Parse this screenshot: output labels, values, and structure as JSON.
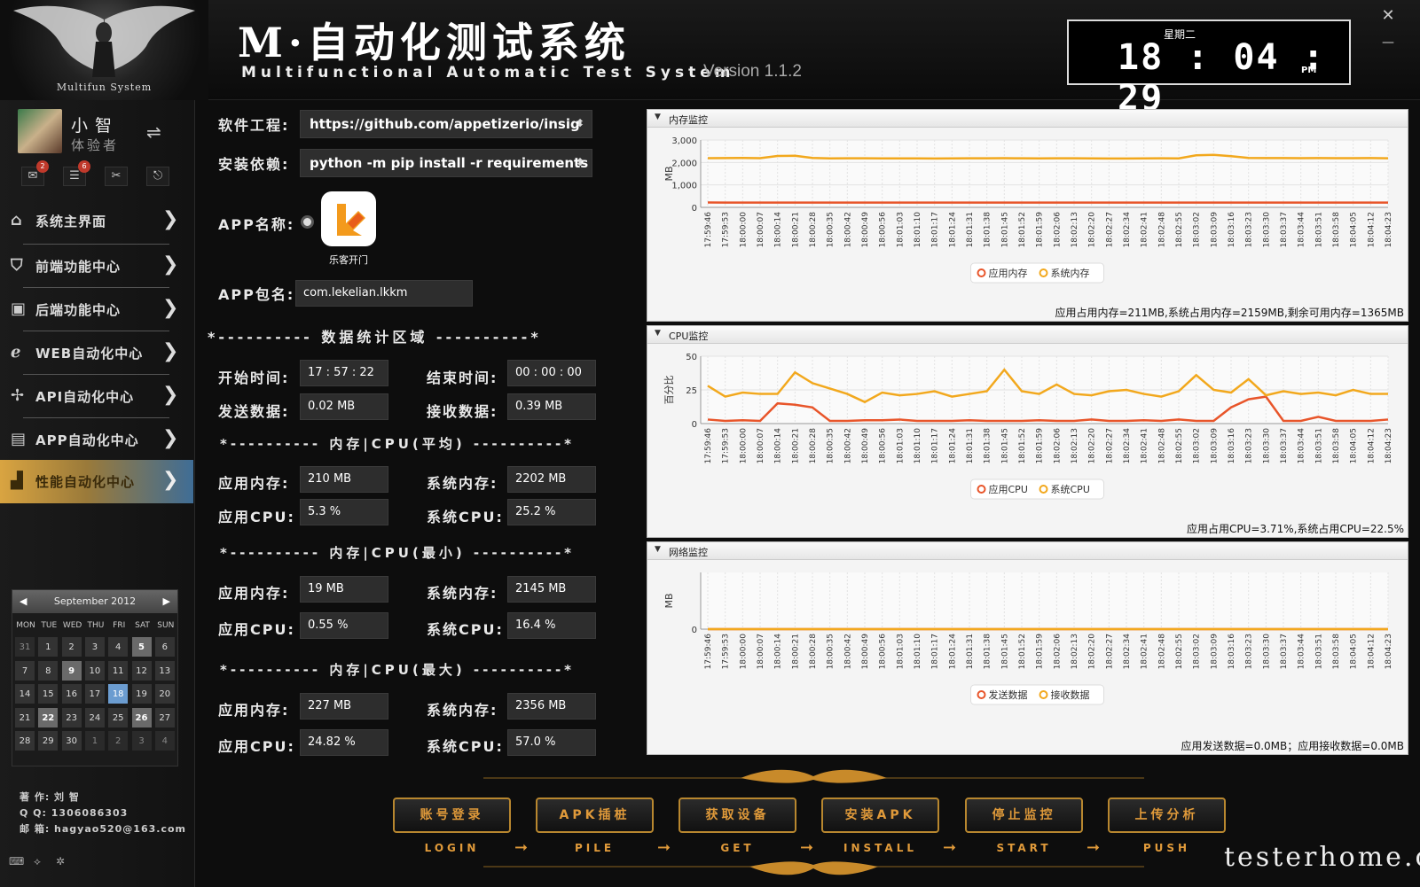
{
  "header": {
    "logo_text": "Multifun System",
    "title": "M·自动化测试系统",
    "subtitle": "Multifunctional Automatic Test System",
    "version": "Version 1.1.2",
    "clock": {
      "weekday": "星期二",
      "time": "18 : 04 : 29",
      "ampm": "PM"
    }
  },
  "user": {
    "name": "小智",
    "role": "体验者",
    "badges": [
      "2",
      "6"
    ]
  },
  "nav": [
    {
      "label": "系统主界面",
      "icon": "home-icon"
    },
    {
      "label": "前端功能中心",
      "icon": "shield-icon"
    },
    {
      "label": "后端功能中心",
      "icon": "chart-monitor-icon"
    },
    {
      "label": "WEB自动化中心",
      "icon": "ie-icon"
    },
    {
      "label": "API自动化中心",
      "icon": "puzzle-icon"
    },
    {
      "label": "APP自动化中心",
      "icon": "app-icon"
    },
    {
      "label": "性能自动化中心",
      "icon": "bar-chart-icon"
    }
  ],
  "calendar": {
    "month": "September 2012",
    "dow": [
      "MON",
      "TUE",
      "WED",
      "THU",
      "FRI",
      "SAT",
      "SUN"
    ],
    "weeks": [
      [
        "31",
        "1",
        "2",
        "3",
        "4",
        "5",
        "6"
      ],
      [
        "7",
        "8",
        "9",
        "10",
        "11",
        "12",
        "13"
      ],
      [
        "14",
        "15",
        "16",
        "17",
        "18",
        "19",
        "20"
      ],
      [
        "21",
        "22",
        "23",
        "24",
        "25",
        "26",
        "27"
      ],
      [
        "28",
        "29",
        "30",
        "1",
        "2",
        "3",
        "4"
      ]
    ]
  },
  "author": {
    "line1": "著 作: 刘 智",
    "line2": "Q Q: 1306086303",
    "line3": "邮 箱: hagyao520@163.com"
  },
  "form": {
    "project_label": "软件工程:",
    "project_value": "https://github.com/appetizerio/insig",
    "deps_label": "安装依赖:",
    "deps_value": "python -m pip install -r requirements",
    "app_name_label": "APP名称:",
    "app_icon_label": "乐客开门",
    "app_pkg_label": "APP包名:",
    "app_pkg_value": "com.lekelian.lkkm",
    "stats_header": "*---------- 数据统计区域 ----------*",
    "start_label": "开始时间:",
    "start_value": "17 : 57 : 22",
    "end_label": "结束时间:",
    "end_value": "00 : 00 : 00",
    "send_label": "发送数据:",
    "send_value": "0.02 MB",
    "recv_label": "接收数据:",
    "recv_value": "0.39 MB",
    "avg_header": "*---------- 内存|CPU(平均) ----------*",
    "min_header": "*---------- 内存|CPU(最小) ----------*",
    "max_header": "*---------- 内存|CPU(最大) ----------*",
    "app_mem_label": "应用内存:",
    "sys_mem_label": "系统内存:",
    "app_cpu_label": "应用CPU:",
    "sys_cpu_label": "系统CPU:",
    "avg": {
      "app_mem": "210 MB",
      "sys_mem": "2202 MB",
      "app_cpu": "5.3 %",
      "sys_cpu": "25.2 %"
    },
    "min": {
      "app_mem": "19 MB",
      "sys_mem": "2145 MB",
      "app_cpu": "0.55 %",
      "sys_cpu": "16.4 %"
    },
    "max": {
      "app_mem": "227 MB",
      "sys_mem": "2356 MB",
      "app_cpu": "24.82 %",
      "sys_cpu": "57.0 %"
    }
  },
  "panels": {
    "memory": {
      "title": "内存监控",
      "stat": "应用占用内存=211MB,系统占用内存=2159MB,剩余可用内存=1365MB"
    },
    "cpu": {
      "title": "CPU监控",
      "stat": "应用占用CPU=3.71%,系统占用CPU=22.5%"
    },
    "network": {
      "title": "网络监控",
      "stat": "应用发送数据=0.0MB；应用接收数据=0.0MB"
    }
  },
  "colors": {
    "series1": "#e8552a",
    "series2": "#f2a81d",
    "accent": "#e09a3a"
  },
  "buttons": [
    {
      "label": "账号登录",
      "sub": "LOGIN"
    },
    {
      "label": "APK插桩",
      "sub": "PILE"
    },
    {
      "label": "获取设备",
      "sub": "GET"
    },
    {
      "label": "安装APK",
      "sub": "INSTALL"
    },
    {
      "label": "停止监控",
      "sub": "START"
    },
    {
      "label": "上传分析",
      "sub": "PUSH"
    }
  ],
  "watermark": "testerhome.com",
  "chart_data": [
    {
      "type": "line",
      "title": "内存监控",
      "ylabel": "MB",
      "ylim": [
        0,
        3000
      ],
      "yticks": [
        "3,000",
        "2,000",
        "1,000",
        "0"
      ],
      "x": [
        "17:59:46",
        "17:59:53",
        "18:00:00",
        "18:00:07",
        "18:00:14",
        "18:00:21",
        "18:00:28",
        "18:00:35",
        "18:00:42",
        "18:00:49",
        "18:00:56",
        "18:01:03",
        "18:01:10",
        "18:01:17",
        "18:01:24",
        "18:01:31",
        "18:01:38",
        "18:01:45",
        "18:01:52",
        "18:01:59",
        "18:02:06",
        "18:02:13",
        "18:02:20",
        "18:02:27",
        "18:02:34",
        "18:02:41",
        "18:02:48",
        "18:02:55",
        "18:03:02",
        "18:03:09",
        "18:03:16",
        "18:03:23",
        "18:03:30",
        "18:03:37",
        "18:03:44",
        "18:03:51",
        "18:03:58",
        "18:04:05",
        "18:04:12",
        "18:04:23"
      ],
      "series": [
        {
          "name": "应用内存",
          "values": [
            215,
            214,
            214,
            213,
            213,
            212,
            212,
            212,
            211,
            211,
            211,
            211,
            211,
            210,
            210,
            210,
            210,
            211,
            211,
            211,
            211,
            211,
            211,
            211,
            211,
            211,
            211,
            212,
            212,
            212,
            211,
            211,
            211,
            211,
            211,
            211,
            211,
            211,
            211,
            211
          ]
        },
        {
          "name": "系统内存",
          "values": [
            2190,
            2195,
            2200,
            2190,
            2290,
            2300,
            2200,
            2180,
            2185,
            2185,
            2180,
            2180,
            2180,
            2175,
            2180,
            2185,
            2185,
            2190,
            2185,
            2180,
            2185,
            2185,
            2180,
            2175,
            2175,
            2180,
            2185,
            2180,
            2320,
            2340,
            2280,
            2200,
            2195,
            2195,
            2190,
            2195,
            2190,
            2190,
            2195,
            2185
          ]
        }
      ],
      "legend_position": "bottom"
    },
    {
      "type": "line",
      "title": "CPU监控",
      "ylabel": "百分比",
      "ylim": [
        0,
        50
      ],
      "yticks": [
        "50",
        "25",
        "0"
      ],
      "x": [
        "17:59:46",
        "17:59:53",
        "18:00:00",
        "18:00:07",
        "18:00:14",
        "18:00:21",
        "18:00:28",
        "18:00:35",
        "18:00:42",
        "18:00:49",
        "18:00:56",
        "18:01:03",
        "18:01:10",
        "18:01:17",
        "18:01:24",
        "18:01:31",
        "18:01:38",
        "18:01:45",
        "18:01:52",
        "18:01:59",
        "18:02:06",
        "18:02:13",
        "18:02:20",
        "18:02:27",
        "18:02:34",
        "18:02:41",
        "18:02:48",
        "18:02:55",
        "18:03:02",
        "18:03:09",
        "18:03:16",
        "18:03:23",
        "18:03:30",
        "18:03:37",
        "18:03:44",
        "18:03:51",
        "18:03:58",
        "18:04:05",
        "18:04:12",
        "18:04:23"
      ],
      "series": [
        {
          "name": "应用CPU",
          "values": [
            3,
            2,
            2.5,
            2,
            15,
            14,
            12,
            2,
            2,
            2.5,
            2.5,
            3,
            2,
            2,
            2,
            2.5,
            2,
            2,
            2,
            2.5,
            2,
            2,
            3,
            2,
            2,
            2.5,
            2,
            3,
            2,
            2,
            12,
            18,
            20,
            2,
            2,
            5,
            2,
            2,
            2,
            3
          ]
        },
        {
          "name": "系统CPU",
          "values": [
            28,
            20,
            23,
            22,
            22,
            38,
            30,
            26,
            22,
            16,
            23,
            21,
            22,
            24,
            20,
            22,
            24,
            40,
            24,
            22,
            29,
            22,
            21,
            24,
            25,
            22,
            20,
            24,
            36,
            25,
            23,
            33,
            21,
            24,
            22,
            23,
            21,
            25,
            22,
            22
          ]
        }
      ],
      "legend_position": "bottom"
    },
    {
      "type": "line",
      "title": "网络监控",
      "ylabel": "MB",
      "yticks": [
        "0"
      ],
      "x": [
        "17:59:46",
        "17:59:53",
        "18:00:00",
        "18:00:07",
        "18:00:14",
        "18:00:21",
        "18:00:28",
        "18:00:35",
        "18:00:42",
        "18:00:49",
        "18:00:56",
        "18:01:03",
        "18:01:10",
        "18:01:17",
        "18:01:24",
        "18:01:31",
        "18:01:38",
        "18:01:45",
        "18:01:52",
        "18:01:59",
        "18:02:06",
        "18:02:13",
        "18:02:20",
        "18:02:27",
        "18:02:34",
        "18:02:41",
        "18:02:48",
        "18:02:55",
        "18:03:02",
        "18:03:09",
        "18:03:16",
        "18:03:23",
        "18:03:30",
        "18:03:37",
        "18:03:44",
        "18:03:51",
        "18:03:58",
        "18:04:05",
        "18:04:12",
        "18:04:23"
      ],
      "series": [
        {
          "name": "发送数据",
          "values": [
            0,
            0,
            0,
            0,
            0,
            0,
            0,
            0,
            0,
            0,
            0,
            0,
            0,
            0,
            0,
            0,
            0,
            0,
            0,
            0,
            0,
            0,
            0,
            0,
            0,
            0,
            0,
            0,
            0,
            0,
            0,
            0,
            0,
            0,
            0,
            0,
            0,
            0,
            0,
            0
          ]
        },
        {
          "name": "接收数据",
          "values": [
            0,
            0,
            0,
            0,
            0,
            0,
            0,
            0,
            0,
            0,
            0,
            0,
            0,
            0,
            0,
            0,
            0,
            0,
            0,
            0,
            0,
            0,
            0,
            0,
            0,
            0,
            0,
            0,
            0,
            0,
            0,
            0,
            0,
            0,
            0,
            0,
            0,
            0,
            0,
            0
          ]
        }
      ],
      "legend_position": "bottom"
    }
  ]
}
